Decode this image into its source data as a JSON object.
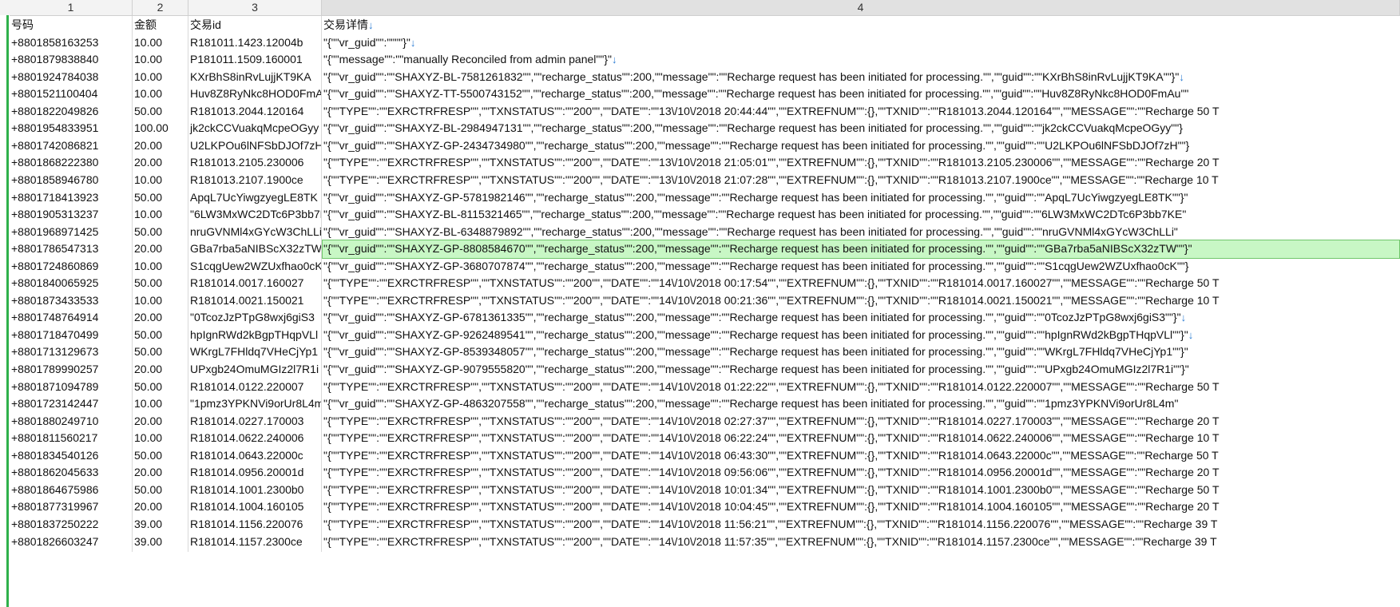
{
  "columns": [
    "1",
    "2",
    "3",
    "4"
  ],
  "rows": [
    {
      "c1": "号码",
      "c2": "金额",
      "c3": "交易id",
      "c4": "交易详情",
      "arrow": "↓"
    },
    {
      "c1": "+8801858163253",
      "c2": "10.00",
      "c3": "R181011.1423.12004b",
      "c4": "\"{\"\"vr_guid\"\":\"\"\"\"}\"",
      "arrow": "↓"
    },
    {
      "c1": "+8801879838840",
      "c2": "10.00",
      "c3": "P181011.1509.160001",
      "c4": "\"{\"\"message\"\":\"\"manually Reconciled from admin panel\"\"}\"",
      "arrow": "↓"
    },
    {
      "c1": "+8801924784038",
      "c2": "10.00",
      "c3": "KXrBhS8inRvLujjKT9KA",
      "c4": "\"{\"\"vr_guid\"\":\"\"SHAXYZ-BL-7581261832\"\",\"\"recharge_status\"\":200,\"\"message\"\":\"\"Recharge request has been initiated for processing.\"\",\"\"guid\"\":\"\"KXrBhS8inRvLujjKT9KA\"\"}\"",
      "arrow": "↓"
    },
    {
      "c1": "+8801521100404",
      "c2": "10.00",
      "c3": "Huv8Z8RyNkc8HOD0FmAu",
      "c4": "\"{\"\"vr_guid\"\":\"\"SHAXYZ-TT-5500743152\"\",\"\"recharge_status\"\":200,\"\"message\"\":\"\"Recharge request has been initiated for processing.\"\",\"\"guid\"\":\"\"Huv8Z8RyNkc8HOD0FmAu\"\"",
      "arrow": ""
    },
    {
      "c1": "+8801822049826",
      "c2": "50.00",
      "c3": "R181013.2044.120164",
      "c4": "\"{\"\"TYPE\"\":\"\"EXRCTRFRESP\"\",\"\"TXNSTATUS\"\":\"\"200\"\",\"\"DATE\"\":\"\"13\\/10\\/2018 20:44:44\"\",\"\"EXTREFNUM\"\":{},\"\"TXNID\"\":\"\"R181013.2044.120164\"\",\"\"MESSAGE\"\":\"\"Recharge 50 T",
      "arrow": ""
    },
    {
      "c1": "+8801954833951",
      "c2": "100.00",
      "c3": "jk2ckCCVuakqMcpeOGyy",
      "c4": "\"{\"\"vr_guid\"\":\"\"SHAXYZ-BL-2984947131\"\",\"\"recharge_status\"\":200,\"\"message\"\":\"\"Recharge request has been initiated for processing.\"\",\"\"guid\"\":\"\"jk2ckCCVuakqMcpeOGyy\"\"}",
      "arrow": ""
    },
    {
      "c1": "+8801742086821",
      "c2": "20.00",
      "c3": "U2LKPOu6lNFSbDJOf7zH",
      "c4": "\"{\"\"vr_guid\"\":\"\"SHAXYZ-GP-2434734980\"\",\"\"recharge_status\"\":200,\"\"message\"\":\"\"Recharge request has been initiated for processing.\"\",\"\"guid\"\":\"\"U2LKPOu6lNFSbDJOf7zH\"\"}",
      "arrow": ""
    },
    {
      "c1": "+8801868222380",
      "c2": "20.00",
      "c3": "R181013.2105.230006",
      "c4": "\"{\"\"TYPE\"\":\"\"EXRCTRFRESP\"\",\"\"TXNSTATUS\"\":\"\"200\"\",\"\"DATE\"\":\"\"13\\/10\\/2018 21:05:01\"\",\"\"EXTREFNUM\"\":{},\"\"TXNID\"\":\"\"R181013.2105.230006\"\",\"\"MESSAGE\"\":\"\"Recharge 20 T",
      "arrow": ""
    },
    {
      "c1": "+8801858946780",
      "c2": "10.00",
      "c3": "R181013.2107.1900ce",
      "c4": "\"{\"\"TYPE\"\":\"\"EXRCTRFRESP\"\",\"\"TXNSTATUS\"\":\"\"200\"\",\"\"DATE\"\":\"\"13\\/10\\/2018 21:07:28\"\",\"\"EXTREFNUM\"\":{},\"\"TXNID\"\":\"\"R181013.2107.1900ce\"\",\"\"MESSAGE\"\":\"\"Recharge 10 T",
      "arrow": ""
    },
    {
      "c1": "+8801718413923",
      "c2": "50.00",
      "c3": "ApqL7UcYiwgzyegLE8TK",
      "c4": "\"{\"\"vr_guid\"\":\"\"SHAXYZ-GP-5781982146\"\",\"\"recharge_status\"\":200,\"\"message\"\":\"\"Recharge request has been initiated for processing.\"\",\"\"guid\"\":\"\"ApqL7UcYiwgzyegLE8TK\"\"}\"",
      "arrow": ""
    },
    {
      "c1": "+8801905313237",
      "c2": "10.00",
      "c3": "\"6LW3MxWC2DTc6P3bb7KE",
      "c4": "\"{\"\"vr_guid\"\":\"\"SHAXYZ-BL-8115321465\"\",\"\"recharge_status\"\":200,\"\"message\"\":\"\"Recharge request has been initiated for processing.\"\",\"\"guid\"\":\"\"6LW3MxWC2DTc6P3bb7KE\"",
      "arrow": ""
    },
    {
      "c1": "+8801968971425",
      "c2": "50.00",
      "c3": "nruGVNMl4xGYcW3ChLLi",
      "c4": "\"{\"\"vr_guid\"\":\"\"SHAXYZ-BL-6348879892\"\",\"\"recharge_status\"\":200,\"\"message\"\":\"\"Recharge request has been initiated for processing.\"\",\"\"guid\"\":\"\"nruGVNMl4xGYcW3ChLLi\"",
      "arrow": ""
    },
    {
      "c1": "+8801786547313",
      "c2": "20.00",
      "c3": "GBa7rba5aNIBScX32zTW",
      "c4": "\"{\"\"vr_guid\"\":\"\"SHAXYZ-GP-8808584670\"\",\"\"recharge_status\"\":200,\"\"message\"\":\"\"Recharge request has been initiated for processing.\"\",\"\"guid\"\":\"\"GBa7rba5aNIBScX32zTW\"\"}\"",
      "arrow": "",
      "highlight": true
    },
    {
      "c1": "+8801724860869",
      "c2": "10.00",
      "c3": "S1cqgUew2WZUxfhao0cK",
      "c4": "\"{\"\"vr_guid\"\":\"\"SHAXYZ-GP-3680707874\"\",\"\"recharge_status\"\":200,\"\"message\"\":\"\"Recharge request has been initiated for processing.\"\",\"\"guid\"\":\"\"S1cqgUew2WZUxfhao0cK\"\"}",
      "arrow": ""
    },
    {
      "c1": "+8801840065925",
      "c2": "50.00",
      "c3": "R181014.0017.160027",
      "c4": "\"{\"\"TYPE\"\":\"\"EXRCTRFRESP\"\",\"\"TXNSTATUS\"\":\"\"200\"\",\"\"DATE\"\":\"\"14\\/10\\/2018 00:17:54\"\",\"\"EXTREFNUM\"\":{},\"\"TXNID\"\":\"\"R181014.0017.160027\"\",\"\"MESSAGE\"\":\"\"Recharge 50 T",
      "arrow": ""
    },
    {
      "c1": "+8801873433533",
      "c2": "10.00",
      "c3": "R181014.0021.150021",
      "c4": "\"{\"\"TYPE\"\":\"\"EXRCTRFRESP\"\",\"\"TXNSTATUS\"\":\"\"200\"\",\"\"DATE\"\":\"\"14\\/10\\/2018 00:21:36\"\",\"\"EXTREFNUM\"\":{},\"\"TXNID\"\":\"\"R181014.0021.150021\"\",\"\"MESSAGE\"\":\"\"Recharge 10 T",
      "arrow": ""
    },
    {
      "c1": "+8801748764914",
      "c2": "20.00",
      "c3": "\"0TcozJzPTpG8wxj6giS3",
      "c4": "\"{\"\"vr_guid\"\":\"\"SHAXYZ-GP-6781361335\"\",\"\"recharge_status\"\":200,\"\"message\"\":\"\"Recharge request has been initiated for processing.\"\",\"\"guid\"\":\"\"0TcozJzPTpG8wxj6giS3\"\"}\"",
      "arrow": "↓"
    },
    {
      "c1": "+8801718470499",
      "c2": "50.00",
      "c3": "hpIgnRWd2kBgpTHqpVLl",
      "c4": "\"{\"\"vr_guid\"\":\"\"SHAXYZ-GP-9262489541\"\",\"\"recharge_status\"\":200,\"\"message\"\":\"\"Recharge request has been initiated for processing.\"\",\"\"guid\"\":\"\"hpIgnRWd2kBgpTHqpVLl\"\"}\"",
      "arrow": "↓"
    },
    {
      "c1": "+8801713129673",
      "c2": "50.00",
      "c3": "WKrgL7FHldq7VHeCjYp1",
      "c4": "\"{\"\"vr_guid\"\":\"\"SHAXYZ-GP-8539348057\"\",\"\"recharge_status\"\":200,\"\"message\"\":\"\"Recharge request has been initiated for processing.\"\",\"\"guid\"\":\"\"WKrgL7FHldq7VHeCjYp1\"\"}\"",
      "arrow": ""
    },
    {
      "c1": "+8801789990257",
      "c2": "20.00",
      "c3": "UPxgb24OmuMGIz2l7R1i",
      "c4": "\"{\"\"vr_guid\"\":\"\"SHAXYZ-GP-9079555820\"\",\"\"recharge_status\"\":200,\"\"message\"\":\"\"Recharge request has been initiated for processing.\"\",\"\"guid\"\":\"\"UPxgb24OmuMGIz2l7R1i\"\"}\"",
      "arrow": ""
    },
    {
      "c1": "+8801871094789",
      "c2": "50.00",
      "c3": "R181014.0122.220007",
      "c4": "\"{\"\"TYPE\"\":\"\"EXRCTRFRESP\"\",\"\"TXNSTATUS\"\":\"\"200\"\",\"\"DATE\"\":\"\"14\\/10\\/2018 01:22:22\"\",\"\"EXTREFNUM\"\":{},\"\"TXNID\"\":\"\"R181014.0122.220007\"\",\"\"MESSAGE\"\":\"\"Recharge 50 T",
      "arrow": ""
    },
    {
      "c1": "+8801723142447",
      "c2": "10.00",
      "c3": "\"1pmz3YPKNVi9orUr8L4m",
      "c4": "\"{\"\"vr_guid\"\":\"\"SHAXYZ-GP-4863207558\"\",\"\"recharge_status\"\":200,\"\"message\"\":\"\"Recharge request has been initiated for processing.\"\",\"\"guid\"\":\"\"1pmz3YPKNVi9orUr8L4m\"",
      "arrow": ""
    },
    {
      "c1": "+8801880249710",
      "c2": "20.00",
      "c3": "R181014.0227.170003",
      "c4": "\"{\"\"TYPE\"\":\"\"EXRCTRFRESP\"\",\"\"TXNSTATUS\"\":\"\"200\"\",\"\"DATE\"\":\"\"14\\/10\\/2018 02:27:37\"\",\"\"EXTREFNUM\"\":{},\"\"TXNID\"\":\"\"R181014.0227.170003\"\",\"\"MESSAGE\"\":\"\"Recharge 20 T",
      "arrow": ""
    },
    {
      "c1": "+8801811560217",
      "c2": "10.00",
      "c3": "R181014.0622.240006",
      "c4": "\"{\"\"TYPE\"\":\"\"EXRCTRFRESP\"\",\"\"TXNSTATUS\"\":\"\"200\"\",\"\"DATE\"\":\"\"14\\/10\\/2018 06:22:24\"\",\"\"EXTREFNUM\"\":{},\"\"TXNID\"\":\"\"R181014.0622.240006\"\",\"\"MESSAGE\"\":\"\"Recharge 10 T",
      "arrow": ""
    },
    {
      "c1": "+8801834540126",
      "c2": "50.00",
      "c3": "R181014.0643.22000c",
      "c4": "\"{\"\"TYPE\"\":\"\"EXRCTRFRESP\"\",\"\"TXNSTATUS\"\":\"\"200\"\",\"\"DATE\"\":\"\"14\\/10\\/2018 06:43:30\"\",\"\"EXTREFNUM\"\":{},\"\"TXNID\"\":\"\"R181014.0643.22000c\"\",\"\"MESSAGE\"\":\"\"Recharge 50 T",
      "arrow": ""
    },
    {
      "c1": "+8801862045633",
      "c2": "20.00",
      "c3": "R181014.0956.20001d",
      "c4": "\"{\"\"TYPE\"\":\"\"EXRCTRFRESP\"\",\"\"TXNSTATUS\"\":\"\"200\"\",\"\"DATE\"\":\"\"14\\/10\\/2018 09:56:06\"\",\"\"EXTREFNUM\"\":{},\"\"TXNID\"\":\"\"R181014.0956.20001d\"\",\"\"MESSAGE\"\":\"\"Recharge 20 T",
      "arrow": ""
    },
    {
      "c1": "+8801864675986",
      "c2": "50.00",
      "c3": "R181014.1001.2300b0",
      "c4": "\"{\"\"TYPE\"\":\"\"EXRCTRFRESP\"\",\"\"TXNSTATUS\"\":\"\"200\"\",\"\"DATE\"\":\"\"14\\/10\\/2018 10:01:34\"\",\"\"EXTREFNUM\"\":{},\"\"TXNID\"\":\"\"R181014.1001.2300b0\"\",\"\"MESSAGE\"\":\"\"Recharge 50 T",
      "arrow": ""
    },
    {
      "c1": "+8801877319967",
      "c2": "20.00",
      "c3": "R181014.1004.160105",
      "c4": "\"{\"\"TYPE\"\":\"\"EXRCTRFRESP\"\",\"\"TXNSTATUS\"\":\"\"200\"\",\"\"DATE\"\":\"\"14\\/10\\/2018 10:04:45\"\",\"\"EXTREFNUM\"\":{},\"\"TXNID\"\":\"\"R181014.1004.160105\"\",\"\"MESSAGE\"\":\"\"Recharge 20 T",
      "arrow": ""
    },
    {
      "c1": "+8801837250222",
      "c2": "39.00",
      "c3": "R181014.1156.220076",
      "c4": "\"{\"\"TYPE\"\":\"\"EXRCTRFRESP\"\",\"\"TXNSTATUS\"\":\"\"200\"\",\"\"DATE\"\":\"\"14\\/10\\/2018 11:56:21\"\",\"\"EXTREFNUM\"\":{},\"\"TXNID\"\":\"\"R181014.1156.220076\"\",\"\"MESSAGE\"\":\"\"Recharge 39 T",
      "arrow": ""
    },
    {
      "c1": "+8801826603247",
      "c2": "39.00",
      "c3": "R181014.1157.2300ce",
      "c4": "\"{\"\"TYPE\"\":\"\"EXRCTRFRESP\"\",\"\"TXNSTATUS\"\":\"\"200\"\",\"\"DATE\"\":\"\"14\\/10\\/2018 11:57:35\"\",\"\"EXTREFNUM\"\":{},\"\"TXNID\"\":\"\"R181014.1157.2300ce\"\",\"\"MESSAGE\"\":\"\"Recharge 39 T",
      "arrow": ""
    }
  ]
}
